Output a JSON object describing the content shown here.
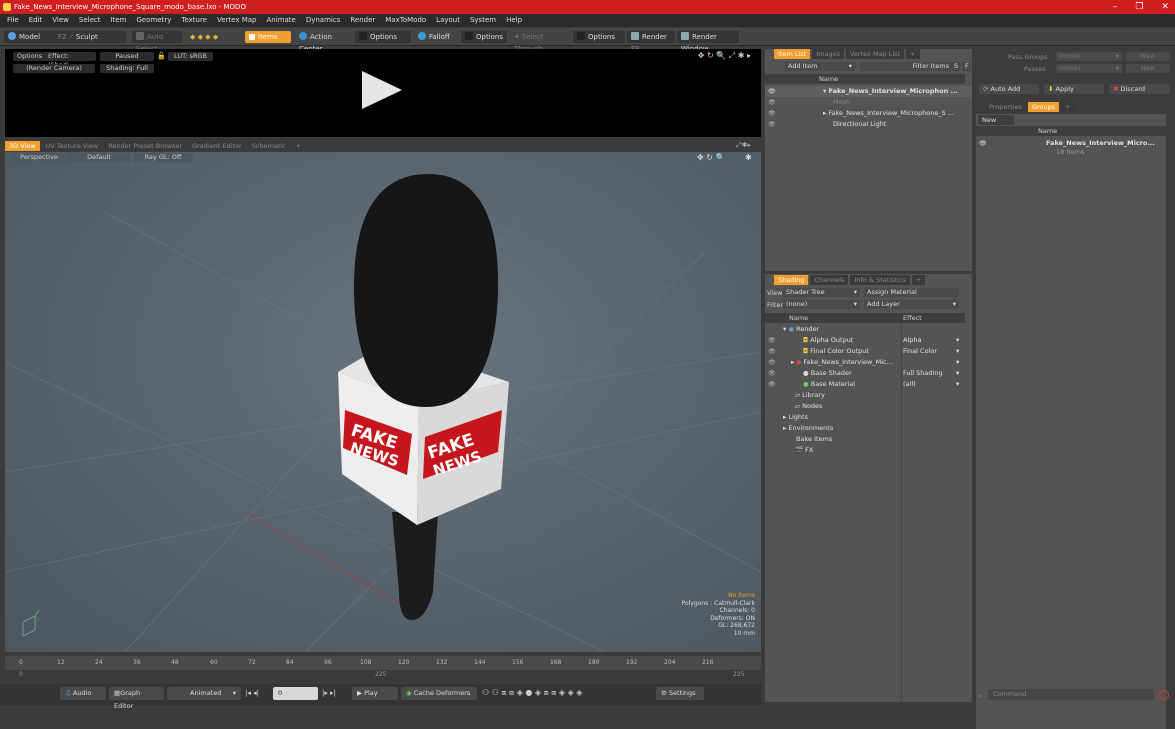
{
  "window": {
    "title": "Fake_News_Interview_Microphone_Square_modo_base.lxo - MODO",
    "controls": [
      "–",
      "❐",
      "✕"
    ]
  },
  "menu": [
    "File",
    "Edit",
    "View",
    "Select",
    "Item",
    "Geometry",
    "Texture",
    "Vertex Map",
    "Animate",
    "Dynamics",
    "Render",
    "MaxToModo",
    "Layout",
    "System",
    "Help"
  ],
  "toolbar": {
    "model": "Model",
    "model_key": "F2",
    "sculpt": "Sculpt",
    "auto_select": "Auto Select",
    "items": "Items",
    "action_center": "Action Center",
    "options1": "Options",
    "falloff": "Falloff",
    "options2": "Options",
    "select_through": "Select Through",
    "options3": "Options",
    "render": "Render",
    "render_key": "F9",
    "render_window": "Render Window"
  },
  "preview": {
    "options": "Options",
    "effect": "Effect: (Shadi...",
    "paused": "Paused",
    "lut": "LUT: sRGB",
    "camera": "(Render Camera)",
    "shading": "Shading: Full"
  },
  "viewport_tabs": [
    "3D View",
    "UV Texture View",
    "Render Preset Browser",
    "Gradient Editor",
    "Schematic",
    "+"
  ],
  "viewport": {
    "perspective": "Perspective",
    "default": "Default",
    "raygl": "Ray GL: Off",
    "info": {
      "no_items": "No Items",
      "polygons": "Polygons : Catmull-Clark",
      "channels": "Channels: 0",
      "deformers": "Deformers: ON",
      "gl": "GL: 268,672",
      "scale": "10 mm"
    },
    "label_left": "FAKE",
    "label_left2": "NEWS",
    "label_right": "FAKE",
    "label_right2": "NEWS"
  },
  "timeline": {
    "ticks": [
      "0",
      "12",
      "24",
      "36",
      "48",
      "60",
      "72",
      "84",
      "96",
      "108",
      "120",
      "132",
      "144",
      "156",
      "168",
      "180",
      "192",
      "204",
      "216"
    ],
    "start": "0",
    "mid": "225",
    "end": "225"
  },
  "bottombar": {
    "audio": "Audio",
    "graph_editor": "Graph Editor",
    "animated": "Animated",
    "frame": "0",
    "play": "Play",
    "cache": "Cache Deformers",
    "settings": "Settings"
  },
  "itemlist": {
    "tabs": [
      "Item List",
      "Images",
      "Vertex Map List",
      "+"
    ],
    "add_item": "Add Item",
    "filter_items": "Filter Items",
    "s": "S",
    "f": "F",
    "col_name": "Name",
    "rows": [
      {
        "label": "Fake_News_Interview_Microphon ...",
        "bold": true
      },
      {
        "label": "Mesh",
        "dim": true
      },
      {
        "label": "Fake_News_Interview_Microphone_S ...",
        "bold": false
      },
      {
        "label": "Directional Light",
        "bold": false
      }
    ]
  },
  "shading": {
    "tabs": [
      "Shading",
      "Channels",
      "Info & Statistics",
      "+"
    ],
    "view_label": "View",
    "view_value": "Shader Tree",
    "assign": "Assign Material",
    "filter_label": "Filter",
    "filter_value": "(none)",
    "add_layer": "Add Layer",
    "col_name": "Name",
    "col_effect": "Effect",
    "rows": [
      {
        "name": "Render",
        "effect": ""
      },
      {
        "name": "Alpha Output",
        "effect": "Alpha"
      },
      {
        "name": "Final Color Output",
        "effect": "Final Color"
      },
      {
        "name": "Fake_News_Interview_Mic...",
        "effect": ""
      },
      {
        "name": "Base Shader",
        "effect": "Full Shading"
      },
      {
        "name": "Base Material",
        "effect": "(all)"
      },
      {
        "name": "Library",
        "effect": ""
      },
      {
        "name": "Nodes",
        "effect": ""
      },
      {
        "name": "Lights",
        "effect": ""
      },
      {
        "name": "Environments",
        "effect": ""
      },
      {
        "name": "Bake Items",
        "effect": ""
      },
      {
        "name": "FX",
        "effect": ""
      }
    ]
  },
  "groups": {
    "pass_groups": "Pass Groups",
    "passes": "Passes",
    "none": "(none)",
    "new": "New",
    "auto_add": "Auto Add",
    "apply": "Apply",
    "discard": "Discard",
    "tabs": [
      "Properties",
      "Groups",
      "+"
    ],
    "new_group": "New Group",
    "col_name": "Name",
    "group_name": "Fake_News_Interview_Micro...",
    "group_count": "18 Items",
    "command_placeholder": "Command"
  }
}
